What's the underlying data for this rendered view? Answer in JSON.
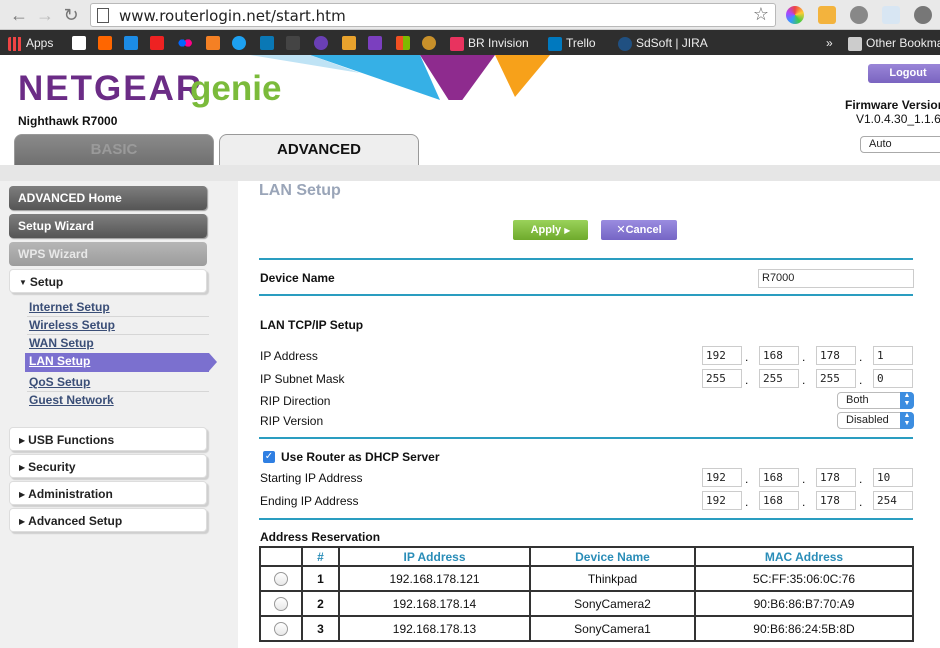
{
  "browser": {
    "url": "www.routerlogin.net/start.htm",
    "bookmarks": [
      "Apps",
      "BR Invision",
      "Trello",
      "SdSoft | JIRA",
      "Other Bookmarks"
    ],
    "more": "»"
  },
  "header": {
    "brand": "NETGEAR",
    "product": "genie",
    "model": "Nighthawk R7000",
    "tabs": {
      "basic": "BASIC",
      "advanced": "ADVANCED"
    },
    "logout": "Logout",
    "firmware_label": "Firmware Version",
    "firmware_value": "V1.0.4.30_1.1.6",
    "update_mode": "Auto"
  },
  "sidebar": {
    "advanced_home": "ADVANCED Home",
    "setup_wizard": "Setup Wizard",
    "wps_wizard": "WPS Wizard",
    "setup": "Setup",
    "setup_items": [
      "Internet Setup",
      "Wireless Setup",
      "WAN Setup",
      "LAN Setup",
      "QoS Setup",
      "Guest Network"
    ],
    "usb": "USB Functions",
    "security": "Security",
    "administration": "Administration",
    "advanced_setup": "Advanced Setup"
  },
  "main": {
    "title": "LAN Setup",
    "apply": "Apply",
    "cancel": "Cancel",
    "device_name_label": "Device Name",
    "device_name": "R7000",
    "lan_tcpip": "LAN TCP/IP Setup",
    "ip_label": "IP Address",
    "ip": [
      "192",
      "168",
      "178",
      "1"
    ],
    "mask_label": "IP Subnet Mask",
    "mask": [
      "255",
      "255",
      "255",
      "0"
    ],
    "rip_dir_label": "RIP Direction",
    "rip_dir": "Both",
    "rip_ver_label": "RIP Version",
    "rip_ver": "Disabled",
    "dhcp_label": "Use Router as DHCP Server",
    "start_label": "Starting IP Address",
    "start_ip": [
      "192",
      "168",
      "178",
      "10"
    ],
    "end_label": "Ending IP Address",
    "end_ip": [
      "192",
      "168",
      "178",
      "254"
    ],
    "reservation_label": "Address Reservation",
    "table": {
      "headers": [
        "#",
        "IP Address",
        "Device Name",
        "MAC Address"
      ],
      "rows": [
        [
          "1",
          "192.168.178.121",
          "Thinkpad",
          "5C:FF:35:06:0C:76"
        ],
        [
          "2",
          "192.168.178.14",
          "SonyCamera2",
          "90:B6:86:B7:70:A9"
        ],
        [
          "3",
          "192.168.178.13",
          "SonyCamera1",
          "90:B6:86:24:5B:8D"
        ]
      ]
    }
  }
}
